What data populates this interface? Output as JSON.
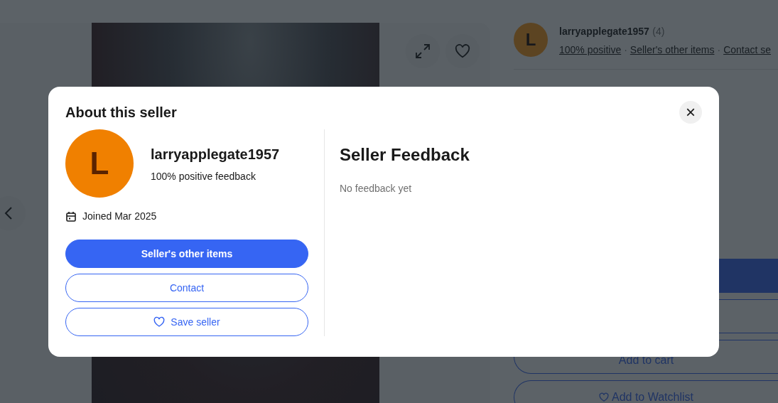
{
  "page": {
    "seller": {
      "avatar_letter": "L",
      "name": "larryapplegate1957",
      "count": "(4)",
      "links": [
        "100% positive",
        "Seller's other items",
        "Contact se"
      ],
      "separator": "·"
    },
    "buttons": [
      {
        "kind": "primary"
      },
      {
        "kind": "secondary"
      },
      {
        "label": "Add to cart",
        "kind": "secondary"
      },
      {
        "label": "Add to Watchlist",
        "kind": "watch"
      }
    ]
  },
  "modal": {
    "title": "About this seller",
    "close": "×",
    "seller": {
      "avatar_letter": "L",
      "name": "larryapplegate1957",
      "feedback": "100% positive feedback",
      "joined": "Joined Mar 2025"
    },
    "buttons": [
      {
        "label": "Seller's other items",
        "kind": "primary"
      },
      {
        "label": "Contact",
        "kind": "secondary"
      },
      {
        "label": "Save seller",
        "kind": "save"
      }
    ],
    "feedback": {
      "title": "Seller Feedback",
      "message": "No feedback yet"
    }
  }
}
